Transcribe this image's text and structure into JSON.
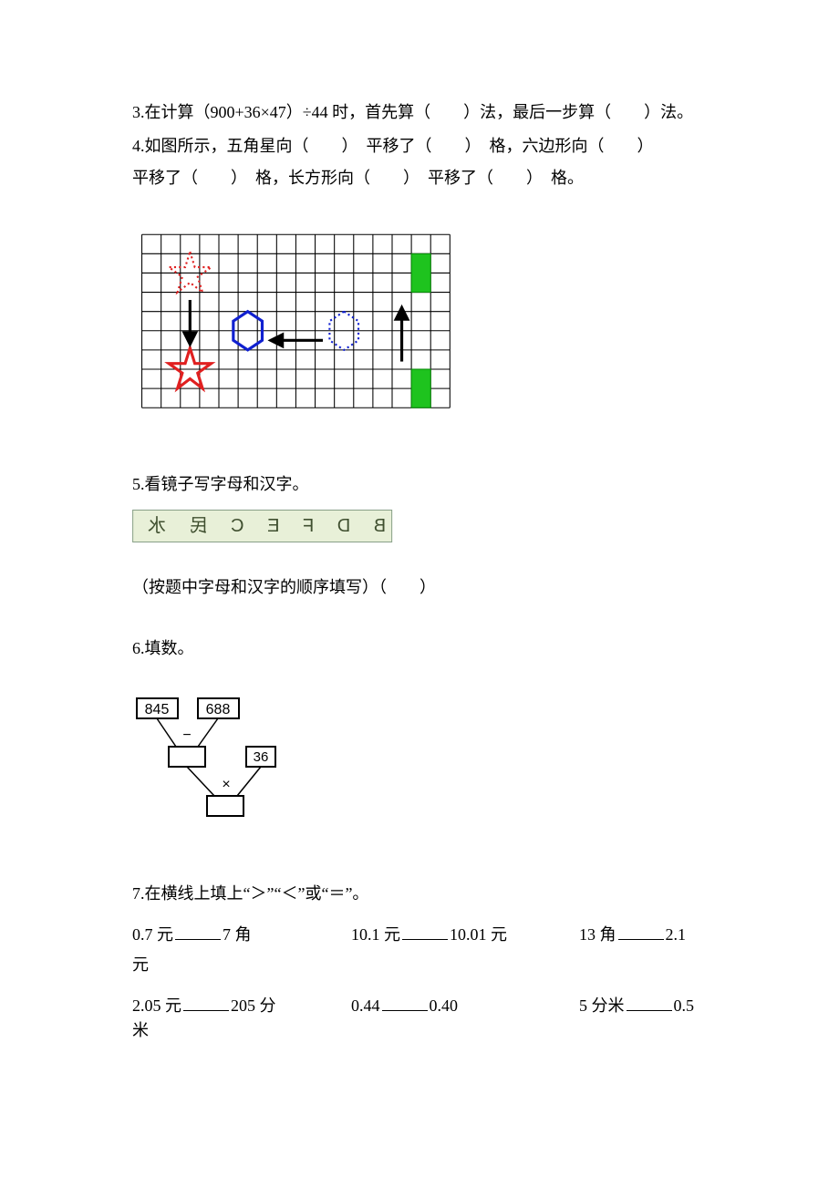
{
  "q3": {
    "prefix": "3.在计算（900+36×47）÷44 时，首先算（　　）法，最后一步算（　　）法。"
  },
  "q4": {
    "line1": "4.如图所示，五角星向（　　）　平移了（　　）　格，六边形向（　　）",
    "line2": "平移了（　　）　格，长方形向（　　）　平移了（　　）　格。"
  },
  "q5": {
    "title": "5.看镜子写字母和汉字。",
    "mirror_text": "B D F E C 民 水",
    "sub": "（按题中字母和汉字的顺序填写）（　　）"
  },
  "q6": {
    "title": "6.填数。",
    "box_a": "845",
    "box_b": "688",
    "box_c": "36",
    "op_minus": "−",
    "op_times": "×"
  },
  "q7": {
    "title": "7.在横线上填上“＞”“＜”或“＝”。",
    "r1c1_a": "0.7 元",
    "r1c1_b": "7 角",
    "r1c2_a": "10.1 元",
    "r1c2_b": "10.01 元",
    "r1c3_a": "13 角",
    "r1c3_b": "2.1",
    "r1c3_tail": "元",
    "r2c1_a": "2.05 元",
    "r2c1_b": "205 分",
    "r2c2_a": "0.44",
    "r2c2_b": "0.40",
    "r2c3_a": "5 分米",
    "r2c3_b": "0.5",
    "r2c3_tail": "米"
  }
}
